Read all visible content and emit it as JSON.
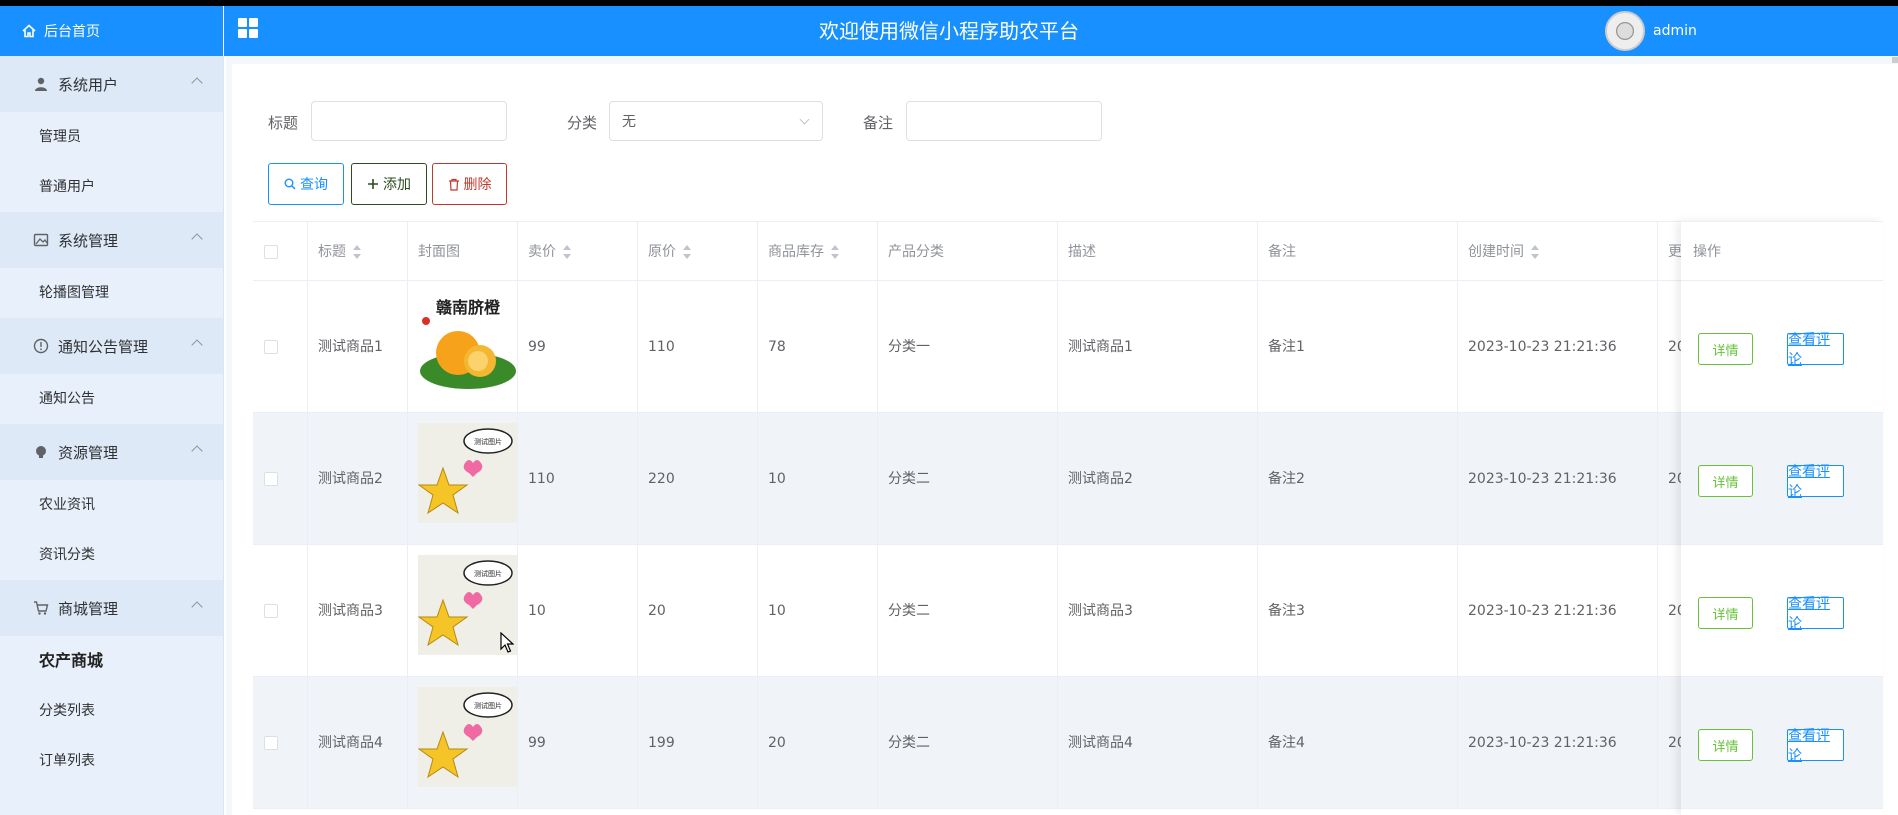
{
  "header": {
    "home_label": "后台首页",
    "title": "欢迎使用微信小程序助农平台",
    "username": "admin"
  },
  "sidebar": {
    "groups": [
      {
        "label": "系统用户",
        "icon": "user-icon",
        "items": [
          "管理员",
          "普通用户"
        ]
      },
      {
        "label": "系统管理",
        "icon": "image-icon",
        "items": [
          "轮播图管理"
        ]
      },
      {
        "label": "通知公告管理",
        "icon": "info-icon",
        "items": [
          "通知公告"
        ]
      },
      {
        "label": "资源管理",
        "icon": "bulb-icon",
        "items": [
          "农业资讯",
          "资讯分类"
        ]
      },
      {
        "label": "商城管理",
        "icon": "cart-icon",
        "items": [
          "农产商城",
          "分类列表",
          "订单列表"
        ]
      }
    ],
    "active_item": "农产商城"
  },
  "filters": {
    "title_label": "标题",
    "title_value": "",
    "category_label": "分类",
    "category_value": "无",
    "remark_label": "备注",
    "remark_value": ""
  },
  "actions": {
    "search": "查询",
    "add": "添加",
    "delete": "删除"
  },
  "table": {
    "columns": [
      "标题",
      "封面图",
      "卖价",
      "原价",
      "商品库存",
      "产品分类",
      "描述",
      "备注",
      "创建时间",
      "更"
    ],
    "action_column": "操作",
    "rows": [
      {
        "title": "测试商品1",
        "cover": "orange",
        "price": "99",
        "original_price": "110",
        "stock": "78",
        "category": "分类一",
        "description": "测试商品1",
        "remark": "备注1",
        "created": "2023-10-23 21:21:36",
        "updated": "20"
      },
      {
        "title": "测试商品2",
        "cover": "star",
        "price": "110",
        "original_price": "220",
        "stock": "10",
        "category": "分类二",
        "description": "测试商品2",
        "remark": "备注2",
        "created": "2023-10-23 21:21:36",
        "updated": "20"
      },
      {
        "title": "测试商品3",
        "cover": "star",
        "price": "10",
        "original_price": "20",
        "stock": "10",
        "category": "分类二",
        "description": "测试商品3",
        "remark": "备注3",
        "created": "2023-10-23 21:21:36",
        "updated": "20"
      },
      {
        "title": "测试商品4",
        "cover": "star",
        "price": "99",
        "original_price": "199",
        "stock": "20",
        "category": "分类二",
        "description": "测试商品4",
        "remark": "备注4",
        "created": "2023-10-23 21:21:36",
        "updated": "20"
      }
    ],
    "detail_label": "详情",
    "comment_label": "查看评论",
    "cover_texts": {
      "orange": "赣南脐橙",
      "star": "测试图片"
    }
  },
  "colors": {
    "header_bg": "#1890ff",
    "sidebar_bg": "#e8f1fb",
    "primary": "#1890ff",
    "success": "#67c23a",
    "danger": "#c0392b"
  }
}
